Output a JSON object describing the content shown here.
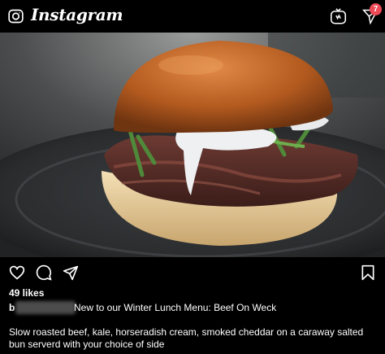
{
  "header": {
    "app_name": "Instagram",
    "dm_badge_count": "7",
    "icons": [
      "camera-icon",
      "igtv-icon",
      "direct-message-icon"
    ]
  },
  "post": {
    "image_alt": "Beef on weck sandwich on a dark plate",
    "likes": "49 likes",
    "caption_user_initial": "b",
    "caption_title": "New to our Winter Lunch Menu: Beef On Weck",
    "caption_body": "Slow roasted beef, kale, horseradish cream, smoked cheddar on a caraway salted bun serverd with your choice of side",
    "actions": [
      "like-icon",
      "comment-icon",
      "share-icon",
      "save-icon"
    ]
  },
  "colors": {
    "background": "#000000",
    "text": "#ffffff",
    "badge": "#ed4956"
  }
}
